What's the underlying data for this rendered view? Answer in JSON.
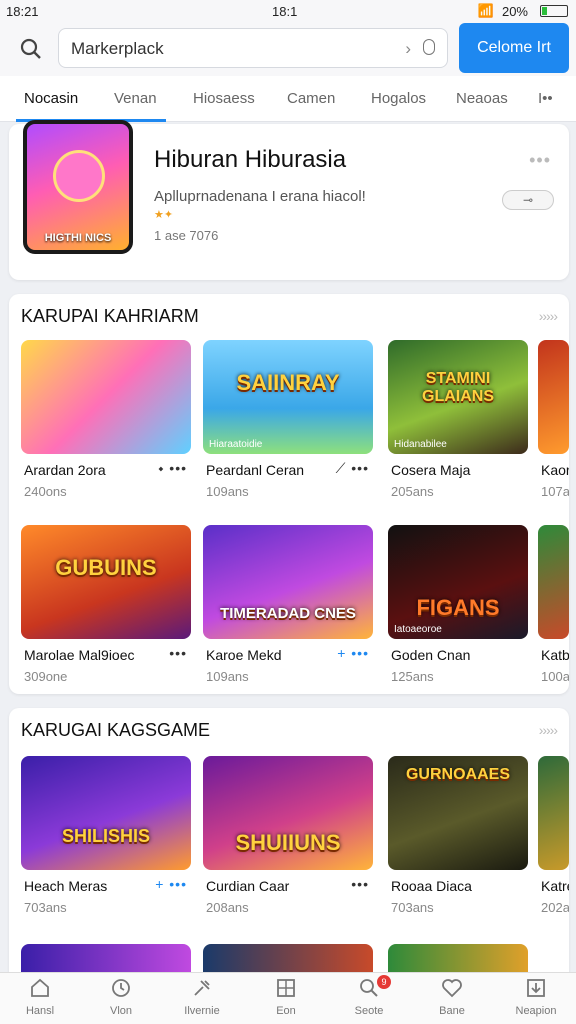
{
  "status_bar": {
    "time_left": "18:21",
    "time_center": "18:1",
    "battery": "20%"
  },
  "header": {
    "search_value": "Markerplack",
    "cta_label": "Celome Irt"
  },
  "tabs": [
    {
      "label": "Nocasin",
      "active": true
    },
    {
      "label": "Venan",
      "active": false
    },
    {
      "label": "Hiosaess",
      "active": false
    },
    {
      "label": "Camen",
      "active": false
    },
    {
      "label": "Hogalos",
      "active": false
    },
    {
      "label": "Neaoas",
      "active": false
    },
    {
      "label": "I••",
      "active": false
    }
  ],
  "featured": {
    "title": "Hiburan Hiburasia",
    "subtitle": "Aplluprnadenana I erana hiacol!",
    "meta": "1 ase 7076",
    "thumb_label": "HIGTHI NICS"
  },
  "sections": [
    {
      "title": "KARUPAI KAHRIARM",
      "rows": [
        [
          {
            "name": "Arardan 2ora",
            "size": "240ons",
            "thumb_title": "",
            "thumb_small": ""
          },
          {
            "name": "Peardanl Ceran",
            "size": "109ans",
            "thumb_title": "SAIINRAY",
            "thumb_small": "Hiaraatoidie"
          },
          {
            "name": "Cosera Maja",
            "size": "205ans",
            "thumb_title": "STAMINI GLAIANS",
            "thumb_small": "Hidanabilee"
          },
          {
            "name": "Kaor",
            "size": "107a",
            "thumb_title": "",
            "thumb_small": ""
          }
        ],
        [
          {
            "name": "Marolae Mal9ioec",
            "size": "309one",
            "thumb_title": "GUBUINS",
            "thumb_small": ""
          },
          {
            "name": "Karoe Mekd",
            "size": "109ans",
            "thumb_title": "TIMERADAD CNES",
            "thumb_small": ""
          },
          {
            "name": "Goden Cnan",
            "size": "125ans",
            "thumb_title": "FIGANS",
            "thumb_small": "Iatoaeoroe"
          },
          {
            "name": "Katb",
            "size": "100a",
            "thumb_title": "",
            "thumb_small": ""
          }
        ]
      ]
    },
    {
      "title": "KARUGAI KAGSGAME",
      "rows": [
        [
          {
            "name": "Heach Meras",
            "size": "703ans",
            "thumb_title": "SHILISHIS",
            "thumb_small": ""
          },
          {
            "name": "Curdian Caar",
            "size": "208ans",
            "thumb_title": "SHUIIUNS",
            "thumb_small": ""
          },
          {
            "name": "Rooaa Diaca",
            "size": "703ans",
            "thumb_title": "GURNOAAES",
            "thumb_small": ""
          },
          {
            "name": "Katre",
            "size": "202a",
            "thumb_title": "",
            "thumb_small": ""
          }
        ]
      ]
    }
  ],
  "bottom_nav": [
    {
      "label": "Hansl",
      "icon": "home-icon"
    },
    {
      "label": "Vlon",
      "icon": "clock-icon"
    },
    {
      "label": "Ilvernie",
      "icon": "tools-icon"
    },
    {
      "label": "Eon",
      "icon": "grid-icon"
    },
    {
      "label": "Seote",
      "icon": "search-icon",
      "badge": "9"
    },
    {
      "label": "Bane",
      "icon": "heart-icon"
    },
    {
      "label": "Neapion",
      "icon": "download-icon"
    }
  ],
  "colors": {
    "accent": "#1e88f0",
    "badge": "#e53935"
  }
}
